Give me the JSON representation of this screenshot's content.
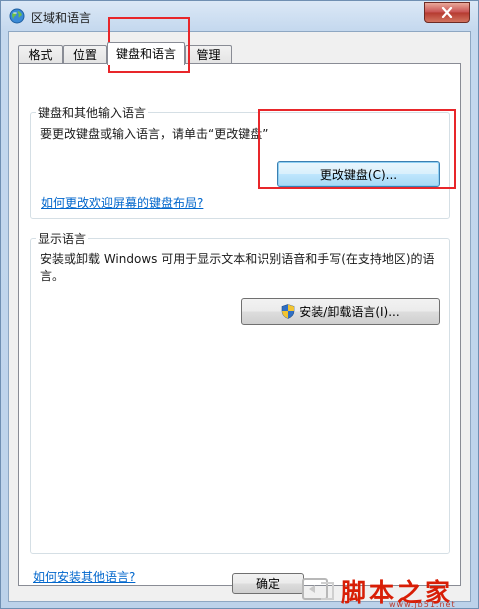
{
  "window": {
    "title": "区域和语言",
    "close_symbol": "✕"
  },
  "tabs": [
    {
      "label": "格式"
    },
    {
      "label": "位置"
    },
    {
      "label": "键盘和语言"
    },
    {
      "label": "管理"
    }
  ],
  "active_tab": "键盘和语言",
  "keyboard_group": {
    "title": "键盘和其他输入语言",
    "description": "要更改键盘或输入语言，请单击“更改键盘”",
    "change_keyboard_button": "更改键盘(C)...",
    "welcome_layout_link": "如何更改欢迎屏幕的键盘布局?"
  },
  "display_group": {
    "title": "显示语言",
    "description_line1": "安装或卸载 Windows 可用于显示文本和识别语音和手写(在支持地区)的语",
    "description_line2": "言。",
    "install_button": "安装/卸载语言(I)...",
    "install_button_icon": "uac-shield-icon"
  },
  "install_other_link": "如何安装其他语言?",
  "ok_button": "确定",
  "watermark": {
    "text": "脚本之家",
    "url": "www.jb51.net"
  },
  "colors": {
    "highlight": "#e8262a",
    "link": "#0066cc",
    "watermark": "#d81e06"
  }
}
